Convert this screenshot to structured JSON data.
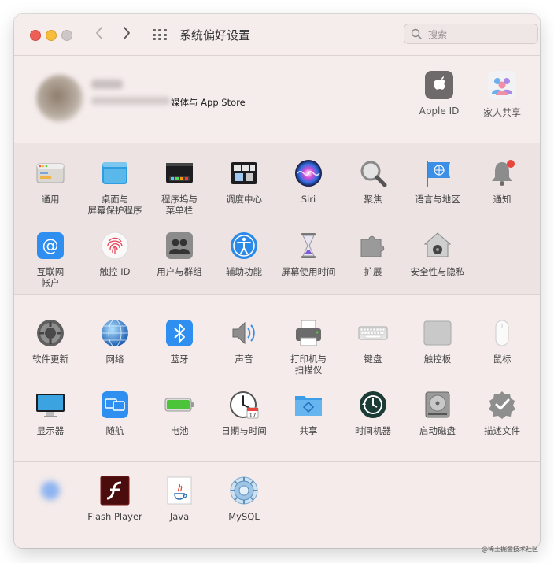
{
  "window": {
    "title": "系统偏好设置"
  },
  "search": {
    "placeholder": "搜索"
  },
  "account": {
    "subtitle": "媒体与 App Store",
    "items": [
      {
        "label": "Apple ID",
        "icon": "apple-icon"
      },
      {
        "label": "家人共享",
        "icon": "family-sharing-icon"
      }
    ]
  },
  "sections": {
    "row1": [
      {
        "label": "通用",
        "icon": "general-icon"
      },
      {
        "label": "桌面与\n屏幕保护程序",
        "icon": "desktop-screensaver-icon"
      },
      {
        "label": "程序坞与\n菜单栏",
        "icon": "dock-menubar-icon"
      },
      {
        "label": "调度中心",
        "icon": "mission-control-icon"
      },
      {
        "label": "Siri",
        "icon": "siri-icon"
      },
      {
        "label": "聚焦",
        "icon": "spotlight-icon"
      },
      {
        "label": "语言与地区",
        "icon": "language-region-icon"
      },
      {
        "label": "通知",
        "icon": "notifications-icon"
      }
    ],
    "row2": [
      {
        "label": "互联网\n帐户",
        "icon": "internet-accounts-icon"
      },
      {
        "label": "触控 ID",
        "icon": "touch-id-icon"
      },
      {
        "label": "用户与群组",
        "icon": "users-groups-icon"
      },
      {
        "label": "辅助功能",
        "icon": "accessibility-icon"
      },
      {
        "label": "屏幕使用时间",
        "icon": "screen-time-icon"
      },
      {
        "label": "扩展",
        "icon": "extensions-icon"
      },
      {
        "label": "安全性与隐私",
        "icon": "security-privacy-icon"
      }
    ],
    "row3": [
      {
        "label": "软件更新",
        "icon": "software-update-icon"
      },
      {
        "label": "网络",
        "icon": "network-icon"
      },
      {
        "label": "蓝牙",
        "icon": "bluetooth-icon"
      },
      {
        "label": "声音",
        "icon": "sound-icon"
      },
      {
        "label": "打印机与\n扫描仪",
        "icon": "printer-icon"
      },
      {
        "label": "键盘",
        "icon": "keyboard-icon"
      },
      {
        "label": "触控板",
        "icon": "trackpad-icon"
      },
      {
        "label": "鼠标",
        "icon": "mouse-icon"
      }
    ],
    "row4": [
      {
        "label": "显示器",
        "icon": "displays-icon"
      },
      {
        "label": "随航",
        "icon": "sidecar-icon"
      },
      {
        "label": "电池",
        "icon": "battery-icon"
      },
      {
        "label": "日期与时间",
        "icon": "date-time-icon"
      },
      {
        "label": "共享",
        "icon": "sharing-icon"
      },
      {
        "label": "时间机器",
        "icon": "time-machine-icon"
      },
      {
        "label": "启动磁盘",
        "icon": "startup-disk-icon"
      },
      {
        "label": "描述文件",
        "icon": "profiles-icon"
      }
    ],
    "row5": [
      {
        "label": "",
        "icon": "blurred-pane-icon"
      },
      {
        "label": "Flash Player",
        "icon": "flash-player-icon"
      },
      {
        "label": "Java",
        "icon": "java-icon"
      },
      {
        "label": "MySQL",
        "icon": "mysql-icon"
      }
    ]
  },
  "watermark": "@稀土掘金技术社区"
}
